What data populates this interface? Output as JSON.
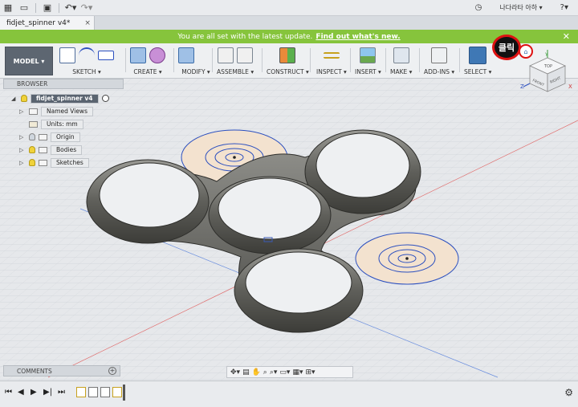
{
  "topbar": {
    "icons": [
      "grid-icon",
      "folder-icon",
      "save-icon",
      "undo-icon",
      "redo-icon"
    ],
    "user_name": "나다라타 아하"
  },
  "document": {
    "tab_title": "fidjet_spinner v4*",
    "tab_close": "×"
  },
  "banner": {
    "text": "You are all set with the latest update.",
    "link": "Find out what's new."
  },
  "ribbon": {
    "workspace": "MODEL",
    "groups": [
      {
        "label": "SKETCH"
      },
      {
        "label": "CREATE"
      },
      {
        "label": "MODIFY"
      },
      {
        "label": "ASSEMBLE"
      },
      {
        "label": "CONSTRUCT"
      },
      {
        "label": "INSPECT"
      },
      {
        "label": "INSERT"
      },
      {
        "label": "MAKE"
      },
      {
        "label": "ADD-INS"
      },
      {
        "label": "SELECT"
      }
    ]
  },
  "browser": {
    "title": "BROWSER",
    "root": "fidjet_spinner v4",
    "items": [
      {
        "label": "Named Views"
      },
      {
        "label": "Units: mm"
      },
      {
        "label": "Origin"
      },
      {
        "label": "Bodies"
      },
      {
        "label": "Sketches"
      }
    ]
  },
  "annotation": {
    "click_label": "클릭"
  },
  "viewcube": {
    "top": "TOP",
    "front": "FRONT",
    "right": "RIGHT",
    "axis_y": "Y",
    "axis_z": "Z",
    "axis_x": "X"
  },
  "comments": {
    "title": "COMMENTS"
  },
  "colors": {
    "banner": "#86c43c",
    "annotation_ring": "#dd1111",
    "sketch_line": "#2b4fbf",
    "sketch_fill": "#f3e2cf",
    "body": "#6d6d68"
  }
}
